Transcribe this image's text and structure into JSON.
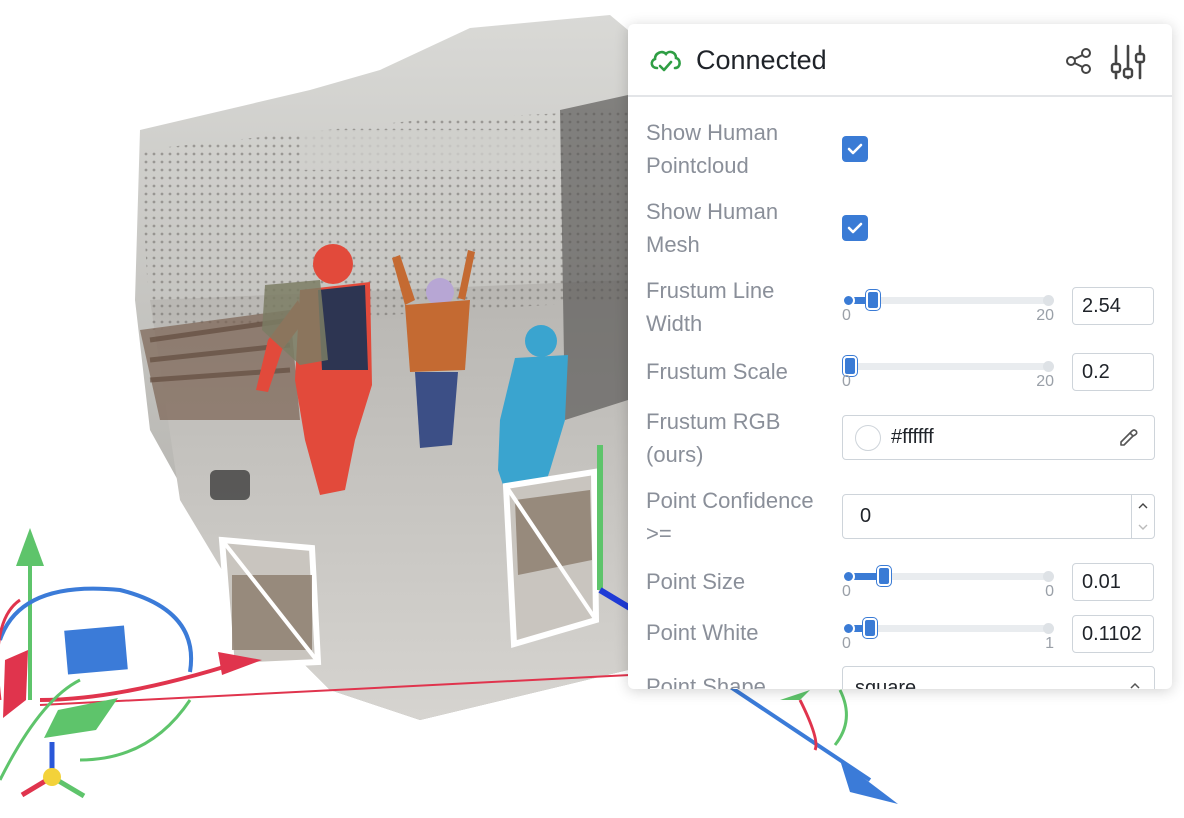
{
  "scene": {
    "description_colors": {
      "axis_red": "#e0344d",
      "axis_green": "#5ec46b",
      "axis_blue": "#3b7bd8",
      "human_red": "#e24a3b",
      "human_blue": "#3aa4cf"
    }
  },
  "panel": {
    "status": "Connected",
    "status_color": "#2f9e44",
    "accent": "#3a7bd5",
    "icons": [
      "cloud-check-icon",
      "share-icon",
      "sliders-icon"
    ],
    "controls": {
      "show_human_pointcloud": {
        "label": "Show Human Pointcloud",
        "checked": true
      },
      "show_human_mesh": {
        "label": "Show Human Mesh",
        "checked": true
      },
      "frustum_line_width": {
        "label": "Frustum Line Width",
        "min": "0",
        "max": "20",
        "value": "2.54",
        "fraction": 0.127
      },
      "frustum_scale": {
        "label": "Frustum Scale",
        "min": "0",
        "max": "20",
        "value": "0.2",
        "fraction": 0.01
      },
      "frustum_rgb": {
        "label": "Frustum RGB (ours)",
        "value": "#ffffff"
      },
      "point_confidence": {
        "label": "Point Confidence >=",
        "value": "0"
      },
      "point_size": {
        "label": "Point Size",
        "min": "0",
        "max": "0",
        "value": "0.01",
        "fraction": 0.18
      },
      "point_white": {
        "label": "Point White",
        "min": "0",
        "max": "1",
        "value": "0.1102",
        "fraction": 0.11
      },
      "point_shape": {
        "label": "Point Shape",
        "value": "square"
      }
    }
  }
}
